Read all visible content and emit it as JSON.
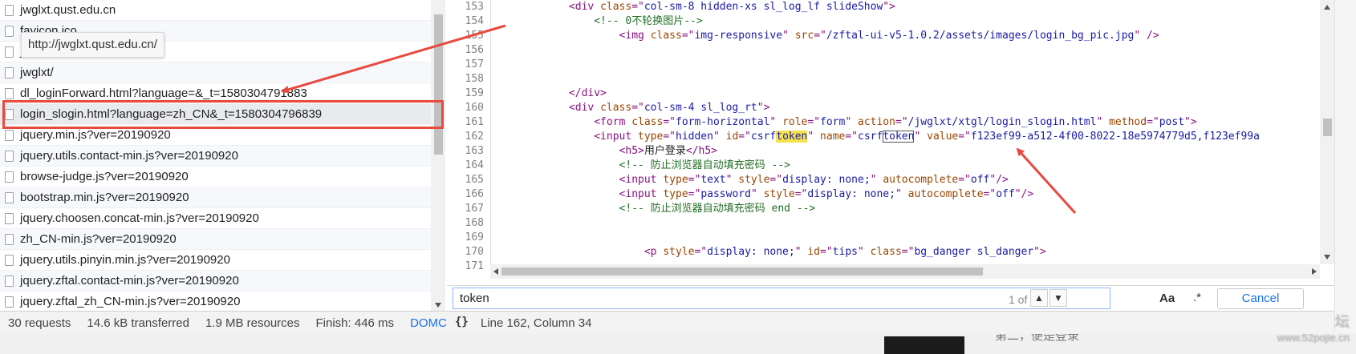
{
  "network": {
    "requests": [
      {
        "name": "jwglxt.qust.edu.cn"
      },
      {
        "name": "favicon.ico"
      },
      {
        "name": "jwglxt"
      },
      {
        "name": "jwglxt/"
      },
      {
        "name": "dl_loginForward.html?language=&_t=1580304791883"
      },
      {
        "name": "login_slogin.html?language=zh_CN&_t=1580304796839"
      },
      {
        "name": "jquery.min.js?ver=20190920"
      },
      {
        "name": "jquery.utils.contact-min.js?ver=20190920"
      },
      {
        "name": "browse-judge.js?ver=20190920"
      },
      {
        "name": "bootstrap.min.js?ver=20190920"
      },
      {
        "name": "jquery.choosen.concat-min.js?ver=20190920"
      },
      {
        "name": "zh_CN-min.js?ver=20190920"
      },
      {
        "name": "jquery.utils.pinyin.min.js?ver=20190920"
      },
      {
        "name": "jquery.zftal.contact-min.js?ver=20190920"
      },
      {
        "name": "jquery.zftal_zh_CN-min.js?ver=20190920"
      }
    ],
    "selected_index": 5,
    "tooltip": "http://jwglxt.qust.edu.cn/",
    "status": {
      "requests": "30 requests",
      "transferred": "14.6 kB transferred",
      "resources": "1.9 MB resources",
      "finish": "Finish: 446 ms",
      "more": "DOMC"
    }
  },
  "editor": {
    "lines": [
      {
        "num": "153",
        "tokens": [
          {
            "t": "            ",
            "c": "tx"
          },
          {
            "t": "<div ",
            "c": "tg"
          },
          {
            "t": "class",
            "c": "an"
          },
          {
            "t": "=\"",
            "c": "tg"
          },
          {
            "t": "col-sm-8 hidden-xs sl_log_lf slideShow",
            "c": "av"
          },
          {
            "t": "\">",
            "c": "tg"
          }
        ]
      },
      {
        "num": "154",
        "tokens": [
          {
            "t": "                ",
            "c": "tx"
          },
          {
            "t": "<!-- 0不轮换图片-->",
            "c": "cm"
          }
        ]
      },
      {
        "num": "155",
        "tokens": [
          {
            "t": "                    ",
            "c": "tx"
          },
          {
            "t": "<img ",
            "c": "tg"
          },
          {
            "t": "class",
            "c": "an"
          },
          {
            "t": "=\"",
            "c": "tg"
          },
          {
            "t": "img-responsive",
            "c": "av"
          },
          {
            "t": "\" ",
            "c": "tg"
          },
          {
            "t": "src",
            "c": "an"
          },
          {
            "t": "=\"",
            "c": "tg"
          },
          {
            "t": "/zftal-ui-v5-1.0.2/assets/images/login_bg_pic.jpg",
            "c": "av"
          },
          {
            "t": "\" />",
            "c": "tg"
          }
        ]
      },
      {
        "num": "156",
        "tokens": []
      },
      {
        "num": "157",
        "tokens": []
      },
      {
        "num": "158",
        "tokens": []
      },
      {
        "num": "159",
        "tokens": [
          {
            "t": "            ",
            "c": "tx"
          },
          {
            "t": "</div>",
            "c": "tg"
          }
        ]
      },
      {
        "num": "160",
        "tokens": [
          {
            "t": "            ",
            "c": "tx"
          },
          {
            "t": "<div ",
            "c": "tg"
          },
          {
            "t": "class",
            "c": "an"
          },
          {
            "t": "=\"",
            "c": "tg"
          },
          {
            "t": "col-sm-4 sl_log_rt",
            "c": "av"
          },
          {
            "t": "\">",
            "c": "tg"
          }
        ]
      },
      {
        "num": "161",
        "tokens": [
          {
            "t": "                ",
            "c": "tx"
          },
          {
            "t": "<form ",
            "c": "tg"
          },
          {
            "t": "class",
            "c": "an"
          },
          {
            "t": "=\"",
            "c": "tg"
          },
          {
            "t": "form-horizontal",
            "c": "av"
          },
          {
            "t": "\" ",
            "c": "tg"
          },
          {
            "t": "role",
            "c": "an"
          },
          {
            "t": "=\"",
            "c": "tg"
          },
          {
            "t": "form",
            "c": "av"
          },
          {
            "t": "\" ",
            "c": "tg"
          },
          {
            "t": "action",
            "c": "an"
          },
          {
            "t": "=\"",
            "c": "tg"
          },
          {
            "t": "/jwglxt/xtgl/login_slogin.html",
            "c": "av"
          },
          {
            "t": "\" ",
            "c": "tg"
          },
          {
            "t": "method",
            "c": "an"
          },
          {
            "t": "=\"",
            "c": "tg"
          },
          {
            "t": "post",
            "c": "av"
          },
          {
            "t": "\">",
            "c": "tg"
          }
        ]
      },
      {
        "num": "162",
        "tokens": [
          {
            "t": "                ",
            "c": "tx"
          },
          {
            "t": "<input ",
            "c": "tg"
          },
          {
            "t": "type",
            "c": "an"
          },
          {
            "t": "=\"",
            "c": "tg"
          },
          {
            "t": "hidden",
            "c": "av"
          },
          {
            "t": "\" ",
            "c": "tg"
          },
          {
            "t": "id",
            "c": "an"
          },
          {
            "t": "=\"",
            "c": "tg"
          },
          {
            "t": "csrf",
            "c": "av"
          },
          {
            "t": "token",
            "c": "av",
            "h": "cur"
          },
          {
            "t": "\" ",
            "c": "tg"
          },
          {
            "t": "name",
            "c": "an"
          },
          {
            "t": "=\"",
            "c": "tg"
          },
          {
            "t": "csrf",
            "c": "av"
          },
          {
            "t": "token",
            "c": "av",
            "h": "box"
          },
          {
            "t": "\" ",
            "c": "tg"
          },
          {
            "t": "value",
            "c": "an"
          },
          {
            "t": "=\"",
            "c": "tg"
          },
          {
            "t": "f123ef99-a512-4f00-8022-18e5974779d5,f123ef99a",
            "c": "av"
          }
        ]
      },
      {
        "num": "163",
        "tokens": [
          {
            "t": "                    ",
            "c": "tx"
          },
          {
            "t": "<h5>",
            "c": "tg"
          },
          {
            "t": "用户登录",
            "c": "tx"
          },
          {
            "t": "</h5>",
            "c": "tg"
          }
        ]
      },
      {
        "num": "164",
        "tokens": [
          {
            "t": "                    ",
            "c": "tx"
          },
          {
            "t": "<!-- 防止浏览器自动填充密码 -->",
            "c": "cm"
          }
        ]
      },
      {
        "num": "165",
        "tokens": [
          {
            "t": "                    ",
            "c": "tx"
          },
          {
            "t": "<input ",
            "c": "tg"
          },
          {
            "t": "type",
            "c": "an"
          },
          {
            "t": "=\"",
            "c": "tg"
          },
          {
            "t": "text",
            "c": "av"
          },
          {
            "t": "\" ",
            "c": "tg"
          },
          {
            "t": "style",
            "c": "an"
          },
          {
            "t": "=\"",
            "c": "tg"
          },
          {
            "t": "display: none;",
            "c": "av"
          },
          {
            "t": "\" ",
            "c": "tg"
          },
          {
            "t": "autocomplete",
            "c": "an"
          },
          {
            "t": "=\"",
            "c": "tg"
          },
          {
            "t": "off",
            "c": "av"
          },
          {
            "t": "\"/>",
            "c": "tg"
          }
        ]
      },
      {
        "num": "166",
        "tokens": [
          {
            "t": "                    ",
            "c": "tx"
          },
          {
            "t": "<input ",
            "c": "tg"
          },
          {
            "t": "type",
            "c": "an"
          },
          {
            "t": "=\"",
            "c": "tg"
          },
          {
            "t": "password",
            "c": "av"
          },
          {
            "t": "\" ",
            "c": "tg"
          },
          {
            "t": "style",
            "c": "an"
          },
          {
            "t": "=\"",
            "c": "tg"
          },
          {
            "t": "display: none;",
            "c": "av"
          },
          {
            "t": "\" ",
            "c": "tg"
          },
          {
            "t": "autocomplete",
            "c": "an"
          },
          {
            "t": "=\"",
            "c": "tg"
          },
          {
            "t": "off",
            "c": "av"
          },
          {
            "t": "\"/>",
            "c": "tg"
          }
        ]
      },
      {
        "num": "167",
        "tokens": [
          {
            "t": "                    ",
            "c": "tx"
          },
          {
            "t": "<!-- 防止浏览器自动填充密码 end -->",
            "c": "cm"
          }
        ]
      },
      {
        "num": "168",
        "tokens": []
      },
      {
        "num": "169",
        "tokens": []
      },
      {
        "num": "170",
        "tokens": [
          {
            "t": "                        ",
            "c": "tx"
          },
          {
            "t": "<p ",
            "c": "tg"
          },
          {
            "t": "style",
            "c": "an"
          },
          {
            "t": "=\"",
            "c": "tg"
          },
          {
            "t": "display: none;",
            "c": "av"
          },
          {
            "t": "\" ",
            "c": "tg"
          },
          {
            "t": "id",
            "c": "an"
          },
          {
            "t": "=\"",
            "c": "tg"
          },
          {
            "t": "tips",
            "c": "av"
          },
          {
            "t": "\" ",
            "c": "tg"
          },
          {
            "t": "class",
            "c": "an"
          },
          {
            "t": "=\"",
            "c": "tg"
          },
          {
            "t": "bg_danger sl_danger",
            "c": "av"
          },
          {
            "t": "\">",
            "c": "tg"
          }
        ]
      },
      {
        "num": "171",
        "tokens": []
      }
    ],
    "search": {
      "query": "token",
      "match_count": "1 of 2",
      "prev_icon": "chevron-up-icon",
      "next_icon": "chevron-down-icon",
      "match_case_label": "Aa",
      "regex_label": ".*",
      "cancel_label": "Cancel"
    },
    "status": {
      "pretty_print": "{}",
      "cursor": "Line 162, Column 34"
    }
  },
  "background": {
    "partial_text": "第二，便是登录",
    "watermark_line1": "吾爱破解论坛",
    "watermark_line2": "www.52pojie.cn"
  },
  "colors": {
    "annotation_red": "#e84a3f",
    "search_highlight": "#f6e24a",
    "tag": "#881280",
    "attr_name": "#994500",
    "attr_value": "#1a1aa6",
    "comment": "#236e25",
    "link": "#1a73e8"
  }
}
